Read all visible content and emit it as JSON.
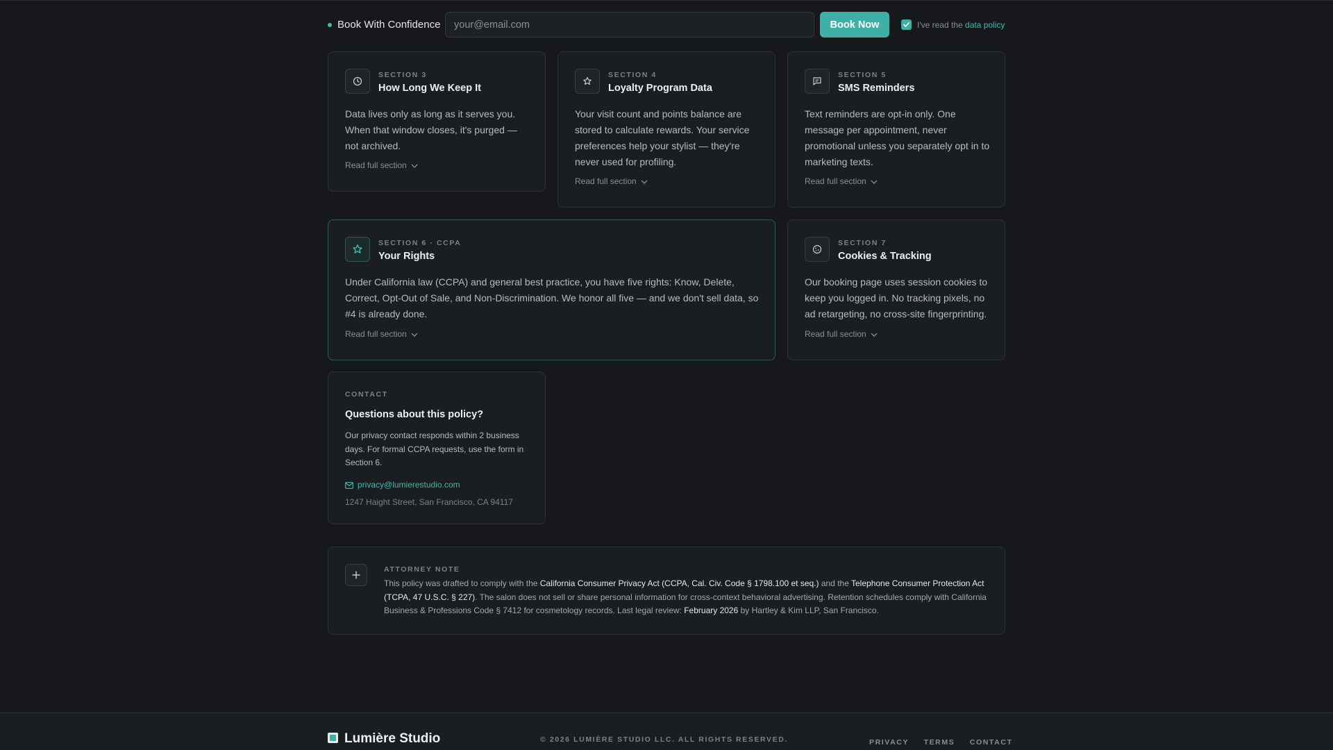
{
  "topbar": {
    "brand_label": "Book With Confidence",
    "email_placeholder": "your@email.com",
    "book_button": "Book Now",
    "agree_prefix": "I've read the",
    "agree_link": "data policy",
    "checkbox_checked": true
  },
  "cards": {
    "retention": {
      "eyebrow": "SECTION 3",
      "title": "How Long We Keep It",
      "body": "Data lives only as long as it serves you. When that window closes, it's purged — not archived.",
      "more": "Read full section",
      "icon": "clock-icon"
    },
    "loyalty": {
      "eyebrow": "SECTION 4",
      "title": "Loyalty Program Data",
      "body": "Your visit count and points balance are stored to calculate rewards. Your service preferences help your stylist — they're never used for profiling.",
      "more": "Read full section",
      "icon": "star-icon"
    },
    "sms": {
      "eyebrow": "SECTION 5",
      "title": "SMS Reminders",
      "body": "Text reminders are opt-in only. One message per appointment, never promotional unless you separately opt in to marketing texts.",
      "more": "Read full section",
      "icon": "message-icon"
    },
    "rights": {
      "eyebrow": "SECTION 6 · CCPA",
      "title": "Your Rights",
      "body": "Under California law (CCPA) and general best practice, you have five rights: Know, Delete, Correct, Opt-Out of Sale, and Non-Discrimination. We honor all five — and we don't sell data, so #4 is already done.",
      "more": "Read full section",
      "icon": "star-icon"
    },
    "cookies": {
      "eyebrow": "SECTION 7",
      "title": "Cookies & Tracking",
      "body": "Our booking page uses session cookies to keep you logged in. No tracking pixels, no ad retargeting, no cross-site fingerprinting.",
      "more": "Read full section",
      "icon": "cookie-icon"
    }
  },
  "contact": {
    "eyebrow": "CONTACT",
    "title": "Questions about this policy?",
    "body": "Our privacy contact responds within 2 business days. For formal CCPA requests, use the form in Section 6.",
    "email": "privacy@lumierestudio.com",
    "address": "1247 Haight Street, San Francisco, CA 94117"
  },
  "attorney": {
    "eyebrow": "ATTORNEY NOTE",
    "t1": "This policy was drafted to comply with the ",
    "h1": "California Consumer Privacy Act (CCPA, Cal. Civ. Code § 1798.100 et seq.)",
    "t2": " and the ",
    "h2": "Telephone Consumer Protection Act (TCPA, 47 U.S.C. § 227)",
    "t3": ". The salon does not sell or share personal information for cross-context behavioral advertising. Retention schedules comply with California Business & Professions Code § 7412 for cosmetology records. Last legal review: ",
    "h3": "February 2026",
    "t4": " by Hartley & Kim LLP, San Francisco."
  },
  "footer": {
    "brand": "Lumière Studio",
    "copyright": "© 2026 LUMIÈRE STUDIO LLC. ALL RIGHTS RESERVED.",
    "links": [
      "PRIVACY",
      "TERMS",
      "CONTACT"
    ]
  },
  "colors": {
    "accent": "#3fb0a5",
    "background": "#16181b",
    "card": "#1b1e21"
  }
}
